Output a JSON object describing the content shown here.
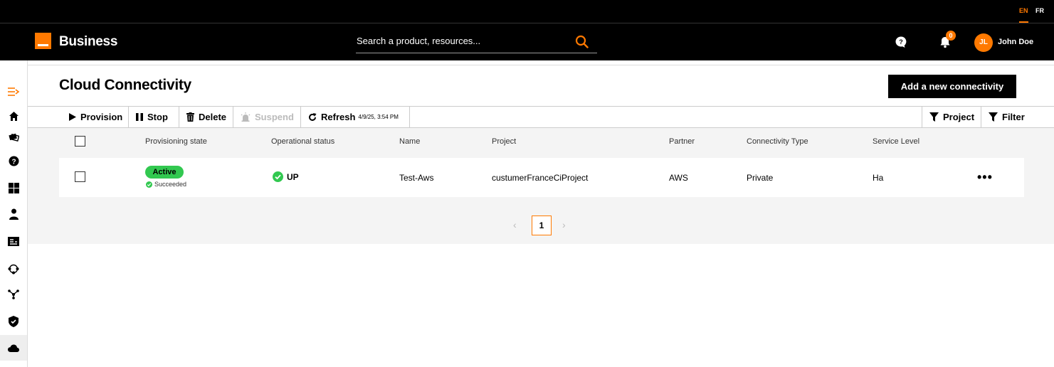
{
  "lang": {
    "en": "EN",
    "fr": "FR"
  },
  "header": {
    "brand": "Business",
    "search_placeholder": "Search a product, resources...",
    "notifications_count": "0",
    "user_initials": "JL",
    "user_name": "John Doe"
  },
  "sidebar": {
    "items": [
      "collapse-menu-icon",
      "home-icon",
      "tickets-icon",
      "help-icon",
      "dashboard-icon",
      "user-icon",
      "billing-icon",
      "network-icon",
      "topology-icon",
      "security-icon",
      "cloud-icon"
    ],
    "active": "cloud-icon"
  },
  "page": {
    "title": "Cloud Connectivity",
    "add_button": "Add a new connectivity"
  },
  "toolbar": {
    "provision": "Provision",
    "stop": "Stop",
    "delete": "Delete",
    "suspend": "Suspend",
    "refresh": "Refresh",
    "refresh_time": "4/9/25, 3:54 PM",
    "project": "Project",
    "filter": "Filter"
  },
  "table": {
    "headers": [
      "Provisioning state",
      "Operational status",
      "Name",
      "Project",
      "Partner",
      "Connectivity Type",
      "Service Level"
    ],
    "rows": [
      {
        "provisioning_state": "Active",
        "provisioning_sub": "Succeeded",
        "operational_status": "UP",
        "name": "Test-Aws",
        "project": "custumerFranceCiProject",
        "partner": "AWS",
        "connectivity_type": "Private",
        "service_level": "Ha",
        "actions": "•••"
      }
    ]
  },
  "pagination": {
    "prev": "‹",
    "current": "1",
    "next": "›"
  },
  "colors": {
    "accent": "#ff7900",
    "active_pill": "#32c850",
    "header_bg": "#000000"
  }
}
